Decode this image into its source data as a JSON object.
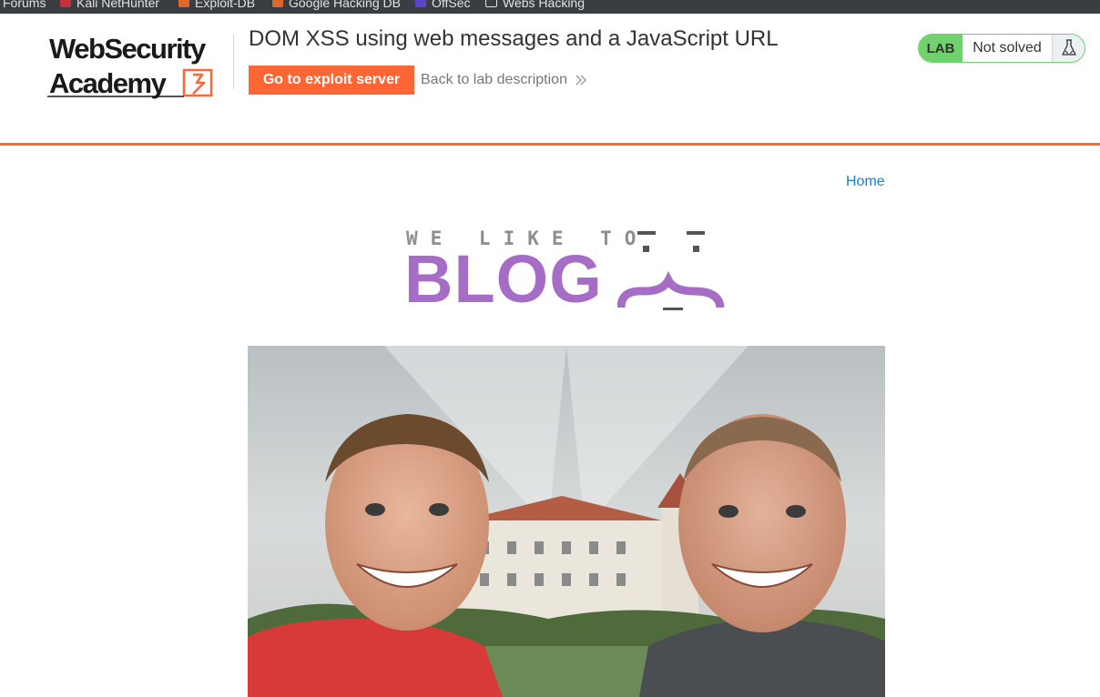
{
  "bookmarks": [
    {
      "label": "Forums",
      "icon": "none"
    },
    {
      "label": "Kali NetHunter",
      "icon": "kali-dragon-icon"
    },
    {
      "label": "Exploit-DB",
      "icon": "exploit-db-icon"
    },
    {
      "label": "Google Hacking DB",
      "icon": "ghdb-icon"
    },
    {
      "label": "OffSec",
      "icon": "offsec-icon"
    },
    {
      "label": "Webs Hacking",
      "icon": "folder-icon"
    }
  ],
  "logo": {
    "line1": "WebSecurity",
    "line2": "Academy"
  },
  "lab": {
    "title": "DOM XSS using web messages and a JavaScript URL",
    "exploit_button": "Go to exploit server",
    "back_link": "Back to lab description",
    "badge": "LAB",
    "status": "Not solved"
  },
  "blog": {
    "home_link": "Home",
    "banner_small": "WE LIKE TO",
    "banner_big": "BLOG"
  },
  "colors": {
    "accent": "#ff6633",
    "lab_green": "#70d16d",
    "blog_purple": "#a66dc6",
    "link_blue": "#1a7fd6"
  }
}
